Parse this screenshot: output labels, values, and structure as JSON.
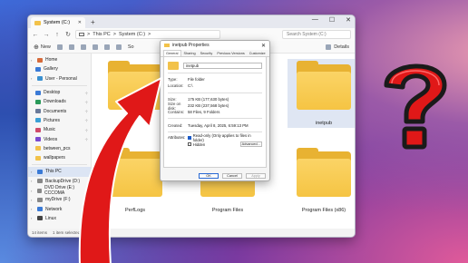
{
  "window": {
    "tab_title": "System (C:)",
    "new_tab": "+",
    "controls": [
      "—",
      "☐",
      "✕"
    ],
    "breadcrumb": [
      "This PC",
      ">",
      "System (C:)",
      ">"
    ],
    "search_placeholder": "Search System (C:)",
    "toolbar": {
      "new": "New",
      "sort": "So",
      "details": "Details"
    }
  },
  "sidebar": {
    "items": [
      {
        "label": "Home",
        "color": "#d66a3a"
      },
      {
        "label": "Gallery",
        "color": "#3a7ad6"
      },
      {
        "label": "User - Personal",
        "color": "#3a90d0"
      },
      {
        "label": "Desktop",
        "color": "#3a7ad6"
      },
      {
        "label": "Downloads",
        "color": "#2a9a5a"
      },
      {
        "label": "Documents",
        "color": "#6a7a9a"
      },
      {
        "label": "Pictures",
        "color": "#3aa0d6"
      },
      {
        "label": "Music",
        "color": "#d04a6a"
      },
      {
        "label": "Videos",
        "color": "#7a4ad0"
      },
      {
        "label": "between_pcs",
        "color": "#f2c24a"
      },
      {
        "label": "wallpapers",
        "color": "#f2c24a"
      },
      {
        "label": "This PC",
        "color": "#3a7ad6"
      },
      {
        "label": "BackupDrive (D:)",
        "color": "#888"
      },
      {
        "label": "DVD Drive (E:) CCCOMA",
        "color": "#888"
      },
      {
        "label": "myDrive (F:)",
        "color": "#888"
      },
      {
        "label": "Network",
        "color": "#3a7ad6"
      },
      {
        "label": "Linux",
        "color": "#444"
      }
    ]
  },
  "folders": [
    {
      "label": ""
    },
    {
      "label": ""
    },
    {
      "label": "inetpub"
    },
    {
      "label": "PerfLogs"
    },
    {
      "label": "Program Files"
    },
    {
      "label": "Program Files (x86)"
    }
  ],
  "status": {
    "items": "14 items",
    "selected": "1 item selected"
  },
  "dialog": {
    "title": "inetpub Properties",
    "close": "✕",
    "tabs": [
      "General",
      "Sharing",
      "Security",
      "Previous Versions",
      "Customize"
    ],
    "name_value": "inetpub",
    "rows": [
      {
        "k": "Type:",
        "v": "File folder"
      },
      {
        "k": "Location:",
        "v": "C:\\"
      },
      {
        "k": "Size:",
        "v": "175 KB (177,630 bytes)"
      },
      {
        "k": "Size on disk:",
        "v": "232 KB (237,568 bytes)"
      },
      {
        "k": "Contains:",
        "v": "58 Files, 9 Folders"
      },
      {
        "k": "Created:",
        "v": "Tuesday, April 8, 2025, 6:59:13 PM"
      }
    ],
    "attributes_label": "Attributes:",
    "readonly_label": "Read-only (Only applies to files in folder)",
    "hidden_label": "Hidden",
    "advanced_label": "Advanced...",
    "ok": "OK",
    "cancel": "Cancel",
    "apply": "Apply"
  },
  "colors": {
    "arrow": "#e01818",
    "qmark": "#e01818",
    "folder": "#f5c443",
    "accent": "#1e5cc8"
  }
}
